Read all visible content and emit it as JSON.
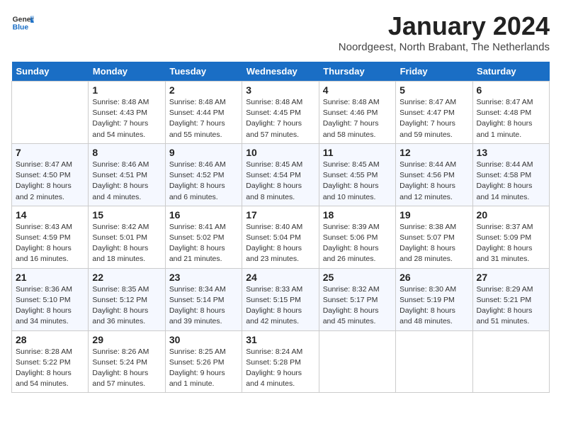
{
  "header": {
    "logo_general": "General",
    "logo_blue": "Blue",
    "title": "January 2024",
    "location": "Noordgeest, North Brabant, The Netherlands"
  },
  "days_of_week": [
    "Sunday",
    "Monday",
    "Tuesday",
    "Wednesday",
    "Thursday",
    "Friday",
    "Saturday"
  ],
  "weeks": [
    [
      {
        "day": "",
        "info": ""
      },
      {
        "day": "1",
        "info": "Sunrise: 8:48 AM\nSunset: 4:43 PM\nDaylight: 7 hours\nand 54 minutes."
      },
      {
        "day": "2",
        "info": "Sunrise: 8:48 AM\nSunset: 4:44 PM\nDaylight: 7 hours\nand 55 minutes."
      },
      {
        "day": "3",
        "info": "Sunrise: 8:48 AM\nSunset: 4:45 PM\nDaylight: 7 hours\nand 57 minutes."
      },
      {
        "day": "4",
        "info": "Sunrise: 8:48 AM\nSunset: 4:46 PM\nDaylight: 7 hours\nand 58 minutes."
      },
      {
        "day": "5",
        "info": "Sunrise: 8:47 AM\nSunset: 4:47 PM\nDaylight: 7 hours\nand 59 minutes."
      },
      {
        "day": "6",
        "info": "Sunrise: 8:47 AM\nSunset: 4:48 PM\nDaylight: 8 hours\nand 1 minute."
      }
    ],
    [
      {
        "day": "7",
        "info": "Sunrise: 8:47 AM\nSunset: 4:50 PM\nDaylight: 8 hours\nand 2 minutes."
      },
      {
        "day": "8",
        "info": "Sunrise: 8:46 AM\nSunset: 4:51 PM\nDaylight: 8 hours\nand 4 minutes."
      },
      {
        "day": "9",
        "info": "Sunrise: 8:46 AM\nSunset: 4:52 PM\nDaylight: 8 hours\nand 6 minutes."
      },
      {
        "day": "10",
        "info": "Sunrise: 8:45 AM\nSunset: 4:54 PM\nDaylight: 8 hours\nand 8 minutes."
      },
      {
        "day": "11",
        "info": "Sunrise: 8:45 AM\nSunset: 4:55 PM\nDaylight: 8 hours\nand 10 minutes."
      },
      {
        "day": "12",
        "info": "Sunrise: 8:44 AM\nSunset: 4:56 PM\nDaylight: 8 hours\nand 12 minutes."
      },
      {
        "day": "13",
        "info": "Sunrise: 8:44 AM\nSunset: 4:58 PM\nDaylight: 8 hours\nand 14 minutes."
      }
    ],
    [
      {
        "day": "14",
        "info": "Sunrise: 8:43 AM\nSunset: 4:59 PM\nDaylight: 8 hours\nand 16 minutes."
      },
      {
        "day": "15",
        "info": "Sunrise: 8:42 AM\nSunset: 5:01 PM\nDaylight: 8 hours\nand 18 minutes."
      },
      {
        "day": "16",
        "info": "Sunrise: 8:41 AM\nSunset: 5:02 PM\nDaylight: 8 hours\nand 21 minutes."
      },
      {
        "day": "17",
        "info": "Sunrise: 8:40 AM\nSunset: 5:04 PM\nDaylight: 8 hours\nand 23 minutes."
      },
      {
        "day": "18",
        "info": "Sunrise: 8:39 AM\nSunset: 5:06 PM\nDaylight: 8 hours\nand 26 minutes."
      },
      {
        "day": "19",
        "info": "Sunrise: 8:38 AM\nSunset: 5:07 PM\nDaylight: 8 hours\nand 28 minutes."
      },
      {
        "day": "20",
        "info": "Sunrise: 8:37 AM\nSunset: 5:09 PM\nDaylight: 8 hours\nand 31 minutes."
      }
    ],
    [
      {
        "day": "21",
        "info": "Sunrise: 8:36 AM\nSunset: 5:10 PM\nDaylight: 8 hours\nand 34 minutes."
      },
      {
        "day": "22",
        "info": "Sunrise: 8:35 AM\nSunset: 5:12 PM\nDaylight: 8 hours\nand 36 minutes."
      },
      {
        "day": "23",
        "info": "Sunrise: 8:34 AM\nSunset: 5:14 PM\nDaylight: 8 hours\nand 39 minutes."
      },
      {
        "day": "24",
        "info": "Sunrise: 8:33 AM\nSunset: 5:15 PM\nDaylight: 8 hours\nand 42 minutes."
      },
      {
        "day": "25",
        "info": "Sunrise: 8:32 AM\nSunset: 5:17 PM\nDaylight: 8 hours\nand 45 minutes."
      },
      {
        "day": "26",
        "info": "Sunrise: 8:30 AM\nSunset: 5:19 PM\nDaylight: 8 hours\nand 48 minutes."
      },
      {
        "day": "27",
        "info": "Sunrise: 8:29 AM\nSunset: 5:21 PM\nDaylight: 8 hours\nand 51 minutes."
      }
    ],
    [
      {
        "day": "28",
        "info": "Sunrise: 8:28 AM\nSunset: 5:22 PM\nDaylight: 8 hours\nand 54 minutes."
      },
      {
        "day": "29",
        "info": "Sunrise: 8:26 AM\nSunset: 5:24 PM\nDaylight: 8 hours\nand 57 minutes."
      },
      {
        "day": "30",
        "info": "Sunrise: 8:25 AM\nSunset: 5:26 PM\nDaylight: 9 hours\nand 1 minute."
      },
      {
        "day": "31",
        "info": "Sunrise: 8:24 AM\nSunset: 5:28 PM\nDaylight: 9 hours\nand 4 minutes."
      },
      {
        "day": "",
        "info": ""
      },
      {
        "day": "",
        "info": ""
      },
      {
        "day": "",
        "info": ""
      }
    ]
  ]
}
